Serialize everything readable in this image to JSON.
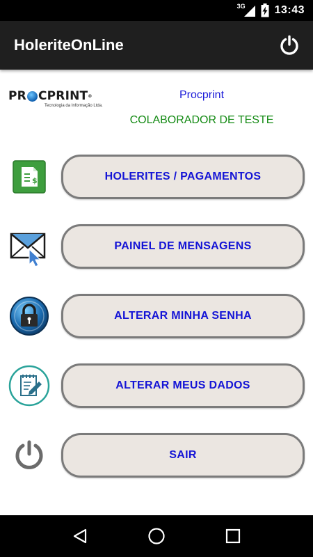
{
  "status_bar": {
    "network": "3G",
    "time": "13:43"
  },
  "app_bar": {
    "title": "HoleriteOnLine"
  },
  "header": {
    "logo_text_left": "PR",
    "logo_text_right": "CPRINT",
    "logo_registered": "®",
    "logo_tagline": "Tecnologia da Informação Ltda.",
    "company": "Procprint",
    "user": "COLABORADOR DE TESTE"
  },
  "menu": {
    "items": [
      {
        "label": "HOLERITES / PAGAMENTOS"
      },
      {
        "label": "PAINEL DE MENSAGENS"
      },
      {
        "label": "ALTERAR MINHA SENHA"
      },
      {
        "label": "ALTERAR MEUS DADOS"
      },
      {
        "label": "SAIR"
      }
    ]
  },
  "icons": {
    "app_bar_power": "power-icon",
    "payslip": "document-money-icon",
    "messages": "envelope-cursor-icon",
    "password": "padlock-icon",
    "edit_data": "notepad-pencil-icon",
    "exit": "power-icon",
    "nav_back": "back-triangle-icon",
    "nav_home": "home-circle-icon",
    "nav_recents": "recents-square-icon"
  },
  "colors": {
    "app_bar": "#1f1f1f",
    "button_bg": "#ebe6e1",
    "button_border": "#7b7b7b",
    "button_text": "#1414d6",
    "company_text": "#1a1ad8",
    "user_text": "#138a13"
  }
}
